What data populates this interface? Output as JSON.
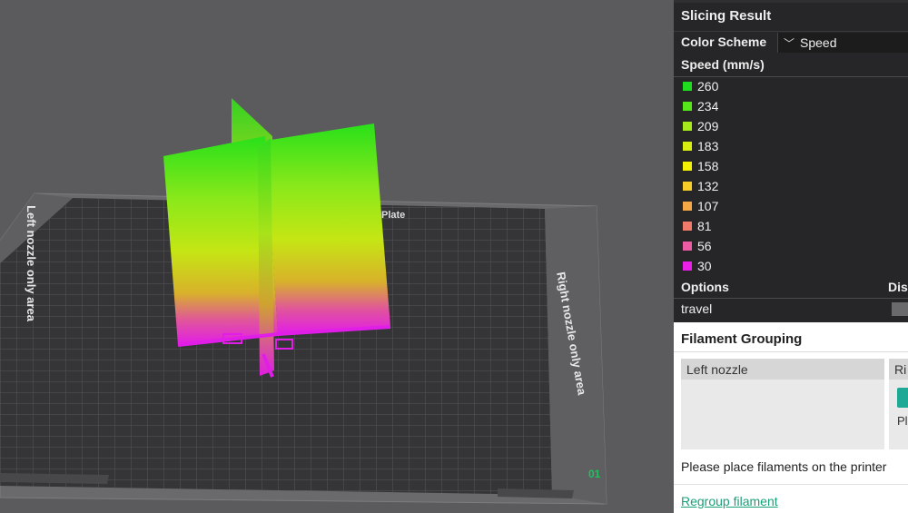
{
  "viewport": {
    "plate_label": "Plate",
    "left_zone_label": "Left nozzle only area",
    "right_zone_label": "Right nozzle only area",
    "plate_index": "01"
  },
  "panel": {
    "title": "Slicing Result",
    "color_scheme_label": "Color Scheme",
    "color_scheme_value": "Speed",
    "speed_label": "Speed (mm/s)",
    "legend": [
      {
        "value": "260",
        "color": "#1fdc1f"
      },
      {
        "value": "234",
        "color": "#56e61a"
      },
      {
        "value": "209",
        "color": "#a6ea1c"
      },
      {
        "value": "183",
        "color": "#d7ee10"
      },
      {
        "value": "158",
        "color": "#f2f004"
      },
      {
        "value": "132",
        "color": "#f7cd2a"
      },
      {
        "value": "107",
        "color": "#f5a848"
      },
      {
        "value": "81",
        "color": "#f07b6a"
      },
      {
        "value": "56",
        "color": "#ec5ca4"
      },
      {
        "value": "30",
        "color": "#ea1fe8"
      }
    ],
    "options_label": "Options",
    "display_label": "Dis",
    "travel_label": "travel"
  },
  "filament_grouping": {
    "title": "Filament Grouping",
    "left_nozzle_label": "Left nozzle",
    "right_nozzle_label": "Ri",
    "right_sub": "Pl",
    "place_text": "Please place filaments on the printer",
    "regroup_link": "Regroup filament"
  }
}
